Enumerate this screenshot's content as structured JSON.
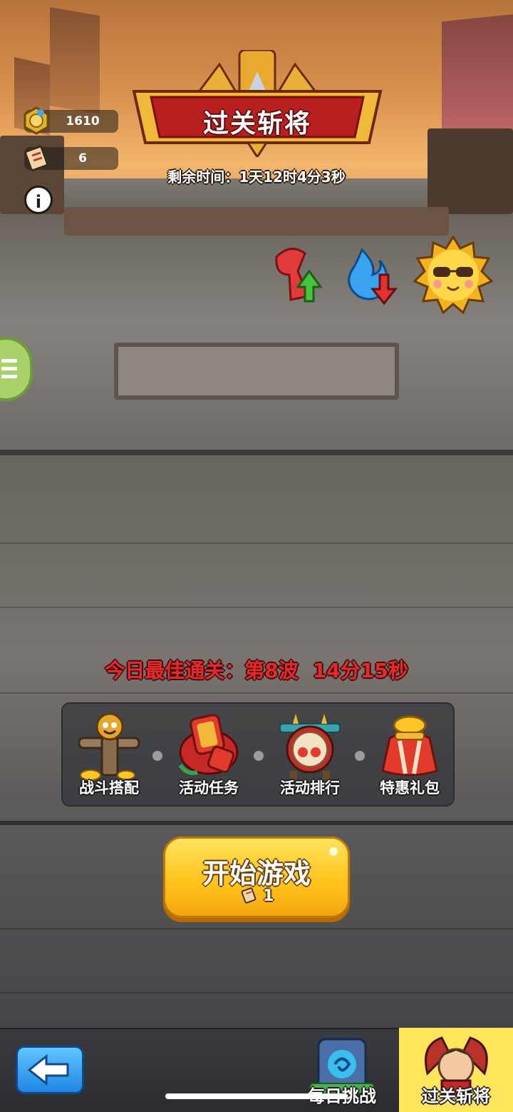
{
  "resources": {
    "coins": {
      "value": "1610",
      "icon": "medal-coin-icon"
    },
    "tickets": {
      "value": "6",
      "icon": "ticket-scroll-icon"
    }
  },
  "info_icon": "i",
  "banner": {
    "title": "过关斩将"
  },
  "timer": {
    "text": "剩余时间：1天12时4分3秒"
  },
  "buffs": [
    {
      "icon": "attack-up-icon"
    },
    {
      "icon": "fire-down-icon"
    },
    {
      "icon": "sunglasses-sun-icon"
    }
  ],
  "best_record": {
    "label": "今日最佳通关：第8波",
    "time": "14分15秒"
  },
  "features": [
    {
      "label": "战斗搭配",
      "icon": "scarecrow-icon"
    },
    {
      "label": "活动任务",
      "icon": "token-shield-icon"
    },
    {
      "label": "活动排行",
      "icon": "war-drum-icon"
    },
    {
      "label": "特惠礼包",
      "icon": "gift-bag-icon"
    }
  ],
  "start_button": {
    "label": "开始游戏",
    "cost": "1",
    "cost_icon": "ticket-scroll-icon"
  },
  "nav": {
    "back_icon": "back-arrow-icon",
    "tabs": [
      {
        "label": "每日挑战",
        "icon": "portal-icon",
        "active": false
      },
      {
        "label": "过关斩将",
        "icon": "warrior-icon",
        "active": true
      }
    ]
  },
  "colors": {
    "accent_yellow": "#ffc21a",
    "banner_red": "#b81f1f",
    "record_red": "#e8292c",
    "back_blue": "#1f86e5"
  }
}
